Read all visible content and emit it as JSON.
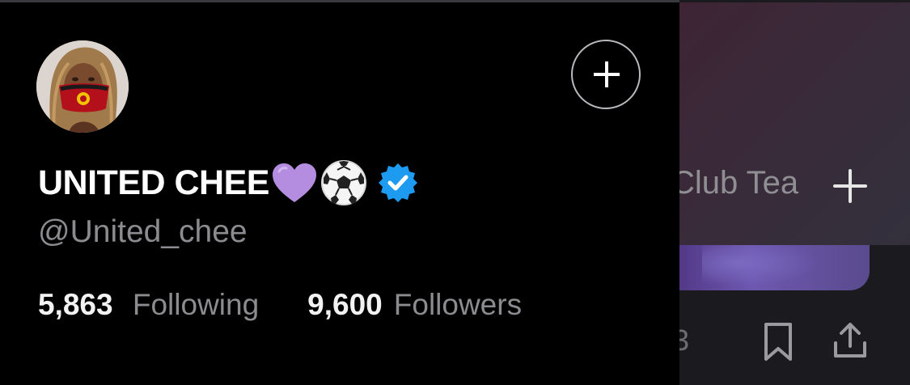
{
  "profile": {
    "display_name": "UNITED CHEE",
    "handle": "@United_chee",
    "verified": true,
    "name_emojis": [
      "purple-heart-icon",
      "soccer-ball-icon"
    ],
    "following_count": "5,863",
    "following_label": "Following",
    "followers_count": "9,600",
    "followers_label": "Followers"
  },
  "background": {
    "tab_label": "Club Tea",
    "count_fragment": "3"
  },
  "colors": {
    "background": "#000000",
    "primary_text": "#ffffff",
    "secondary_text": "#8b8b90",
    "verified_blue": "#1d9bf0",
    "heart_purple": "#b48ce0"
  }
}
